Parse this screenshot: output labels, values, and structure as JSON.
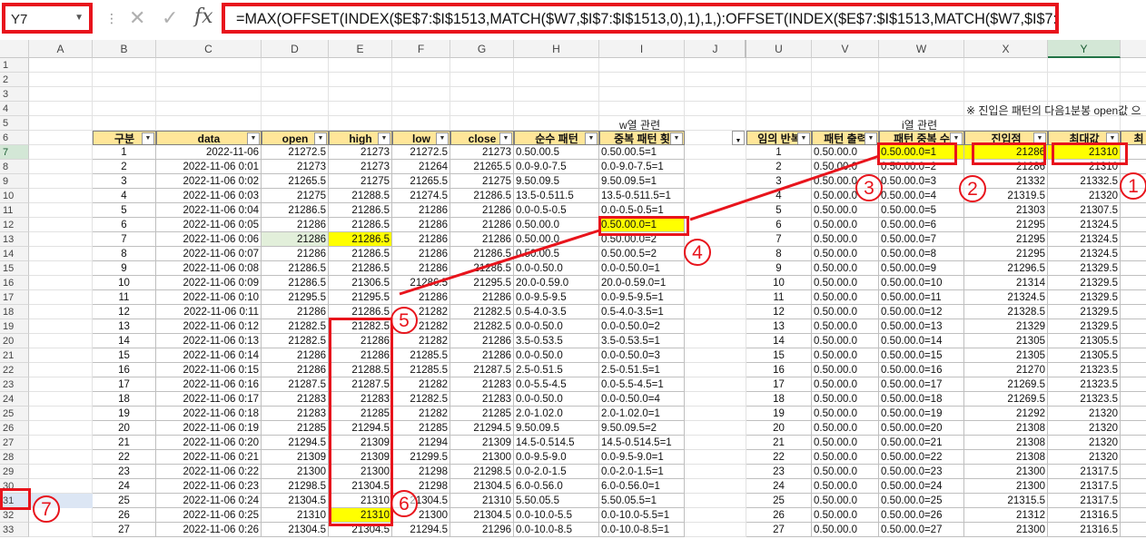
{
  "formula_bar": {
    "name_box": "Y7",
    "formula": "=MAX(OFFSET(INDEX($E$7:$I$1513,MATCH($W7,$I$7:$I$1513,0),1),1,):OFFSET(INDEX($E$7:$I$1513,MATCH($W7,$I$7:$I$1513,0),1),20,))"
  },
  "columns": [
    "A",
    "B",
    "C",
    "D",
    "E",
    "F",
    "G",
    "H",
    "I",
    "J",
    "U",
    "V",
    "W",
    "X",
    "Y"
  ],
  "selected_column": "Y",
  "rows": [
    "1",
    "2",
    "3",
    "4",
    "5",
    "6",
    "7",
    "8",
    "9",
    "10",
    "11",
    "12",
    "13",
    "14",
    "15",
    "16",
    "17",
    "18",
    "19",
    "20",
    "21",
    "22",
    "23",
    "24",
    "25",
    "26",
    "27",
    "28",
    "29",
    "30",
    "31",
    "32",
    "33"
  ],
  "labels": {
    "w_related": "w열 관련",
    "i_related": "i열 관련",
    "note": "※ 진입은 패턴의 다음1분봉 open값 으"
  },
  "left_headers": [
    "구분",
    "data",
    "open",
    "high",
    "low",
    "close",
    "순수 패턴",
    "중복 패턴 횟"
  ],
  "right_headers": [
    "임의 반복",
    "패턴 출력",
    "패턴 중복 수",
    "진입점",
    "최대값",
    "최"
  ],
  "left_rows": [
    [
      "1",
      "2022-11-06",
      "21272.5",
      "21273",
      "21272.5",
      "21273",
      "0.50.00.5",
      "0.50.00.5=1"
    ],
    [
      "2",
      "2022-11-06 0:01",
      "21273",
      "21273",
      "21264",
      "21265.5",
      "0.0-9.0-7.5",
      "0.0-9.0-7.5=1"
    ],
    [
      "3",
      "2022-11-06 0:02",
      "21265.5",
      "21275",
      "21265.5",
      "21275",
      "9.50.09.5",
      "9.50.09.5=1"
    ],
    [
      "4",
      "2022-11-06 0:03",
      "21275",
      "21288.5",
      "21274.5",
      "21286.5",
      "13.5-0.511.5",
      "13.5-0.511.5=1"
    ],
    [
      "5",
      "2022-11-06 0:04",
      "21286.5",
      "21286.5",
      "21286",
      "21286",
      "0.0-0.5-0.5",
      "0.0-0.5-0.5=1"
    ],
    [
      "6",
      "2022-11-06 0:05",
      "21286",
      "21286.5",
      "21286",
      "21286",
      "0.50.00.0",
      "0.50.00.0=1"
    ],
    [
      "7",
      "2022-11-06 0:06",
      "21286",
      "21286.5",
      "21286",
      "21286",
      "0.50.00.0",
      "0.50.00.0=2"
    ],
    [
      "8",
      "2022-11-06 0:07",
      "21286",
      "21286.5",
      "21286",
      "21286.5",
      "0.50.00.5",
      "0.50.00.5=2"
    ],
    [
      "9",
      "2022-11-06 0:08",
      "21286.5",
      "21286.5",
      "21286",
      "21286.5",
      "0.0-0.50.0",
      "0.0-0.50.0=1"
    ],
    [
      "10",
      "2022-11-06 0:09",
      "21286.5",
      "21306.5",
      "21286.5",
      "21295.5",
      "20.0-0.59.0",
      "20.0-0.59.0=1"
    ],
    [
      "11",
      "2022-11-06 0:10",
      "21295.5",
      "21295.5",
      "21286",
      "21286",
      "0.0-9.5-9.5",
      "0.0-9.5-9.5=1"
    ],
    [
      "12",
      "2022-11-06 0:11",
      "21286",
      "21286.5",
      "21282",
      "21282.5",
      "0.5-4.0-3.5",
      "0.5-4.0-3.5=1"
    ],
    [
      "13",
      "2022-11-06 0:12",
      "21282.5",
      "21282.5",
      "21282",
      "21282.5",
      "0.0-0.50.0",
      "0.0-0.50.0=2"
    ],
    [
      "14",
      "2022-11-06 0:13",
      "21282.5",
      "21286",
      "21282",
      "21286",
      "3.5-0.53.5",
      "3.5-0.53.5=1"
    ],
    [
      "15",
      "2022-11-06 0:14",
      "21286",
      "21286",
      "21285.5",
      "21286",
      "0.0-0.50.0",
      "0.0-0.50.0=3"
    ],
    [
      "16",
      "2022-11-06 0:15",
      "21286",
      "21288.5",
      "21285.5",
      "21287.5",
      "2.5-0.51.5",
      "2.5-0.51.5=1"
    ],
    [
      "17",
      "2022-11-06 0:16",
      "21287.5",
      "21287.5",
      "21282",
      "21283",
      "0.0-5.5-4.5",
      "0.0-5.5-4.5=1"
    ],
    [
      "18",
      "2022-11-06 0:17",
      "21283",
      "21283",
      "21282.5",
      "21283",
      "0.0-0.50.0",
      "0.0-0.50.0=4"
    ],
    [
      "19",
      "2022-11-06 0:18",
      "21283",
      "21285",
      "21282",
      "21285",
      "2.0-1.02.0",
      "2.0-1.02.0=1"
    ],
    [
      "20",
      "2022-11-06 0:19",
      "21285",
      "21294.5",
      "21285",
      "21294.5",
      "9.50.09.5",
      "9.50.09.5=2"
    ],
    [
      "21",
      "2022-11-06 0:20",
      "21294.5",
      "21309",
      "21294",
      "21309",
      "14.5-0.514.5",
      "14.5-0.514.5=1"
    ],
    [
      "22",
      "2022-11-06 0:21",
      "21309",
      "21309",
      "21299.5",
      "21300",
      "0.0-9.5-9.0",
      "0.0-9.5-9.0=1"
    ],
    [
      "23",
      "2022-11-06 0:22",
      "21300",
      "21300",
      "21298",
      "21298.5",
      "0.0-2.0-1.5",
      "0.0-2.0-1.5=1"
    ],
    [
      "24",
      "2022-11-06 0:23",
      "21298.5",
      "21304.5",
      "21298",
      "21304.5",
      "6.0-0.56.0",
      "6.0-0.56.0=1"
    ],
    [
      "25",
      "2022-11-06 0:24",
      "21304.5",
      "21310",
      "21304.5",
      "21310",
      "5.50.05.5",
      "5.50.05.5=1"
    ],
    [
      "26",
      "2022-11-06 0:25",
      "21310",
      "21310",
      "21300",
      "21304.5",
      "0.0-10.0-5.5",
      "0.0-10.0-5.5=1"
    ],
    [
      "27",
      "2022-11-06 0:26",
      "21304.5",
      "21304.5",
      "21294.5",
      "21296",
      "0.0-10.0-8.5",
      "0.0-10.0-8.5=1"
    ]
  ],
  "right_rows": [
    [
      "1",
      "0.50.00.0",
      "0.50.00.0=1",
      "21286",
      "21310"
    ],
    [
      "2",
      "0.50.00.0",
      "0.50.00.0=2",
      "21286",
      "21310"
    ],
    [
      "3",
      "0.50.00.0",
      "0.50.00.0=3",
      "21332",
      "21332.5"
    ],
    [
      "4",
      "0.50.00.0",
      "0.50.00.0=4",
      "21319.5",
      "21320"
    ],
    [
      "5",
      "0.50.00.0",
      "0.50.00.0=5",
      "21303",
      "21307.5"
    ],
    [
      "6",
      "0.50.00.0",
      "0.50.00.0=6",
      "21295",
      "21324.5"
    ],
    [
      "7",
      "0.50.00.0",
      "0.50.00.0=7",
      "21295",
      "21324.5"
    ],
    [
      "8",
      "0.50.00.0",
      "0.50.00.0=8",
      "21295",
      "21324.5"
    ],
    [
      "9",
      "0.50.00.0",
      "0.50.00.0=9",
      "21296.5",
      "21329.5"
    ],
    [
      "10",
      "0.50.00.0",
      "0.50.00.0=10",
      "21314",
      "21329.5"
    ],
    [
      "11",
      "0.50.00.0",
      "0.50.00.0=11",
      "21324.5",
      "21329.5"
    ],
    [
      "12",
      "0.50.00.0",
      "0.50.00.0=12",
      "21328.5",
      "21329.5"
    ],
    [
      "13",
      "0.50.00.0",
      "0.50.00.0=13",
      "21329",
      "21329.5"
    ],
    [
      "14",
      "0.50.00.0",
      "0.50.00.0=14",
      "21305",
      "21305.5"
    ],
    [
      "15",
      "0.50.00.0",
      "0.50.00.0=15",
      "21305",
      "21305.5"
    ],
    [
      "16",
      "0.50.00.0",
      "0.50.00.0=16",
      "21270",
      "21323.5"
    ],
    [
      "17",
      "0.50.00.0",
      "0.50.00.0=17",
      "21269.5",
      "21323.5"
    ],
    [
      "18",
      "0.50.00.0",
      "0.50.00.0=18",
      "21269.5",
      "21323.5"
    ],
    [
      "19",
      "0.50.00.0",
      "0.50.00.0=19",
      "21292",
      "21320"
    ],
    [
      "20",
      "0.50.00.0",
      "0.50.00.0=20",
      "21308",
      "21320"
    ],
    [
      "21",
      "0.50.00.0",
      "0.50.00.0=21",
      "21308",
      "21320"
    ],
    [
      "22",
      "0.50.00.0",
      "0.50.00.0=22",
      "21308",
      "21320"
    ],
    [
      "23",
      "0.50.00.0",
      "0.50.00.0=23",
      "21300",
      "21317.5"
    ],
    [
      "24",
      "0.50.00.0",
      "0.50.00.0=24",
      "21300",
      "21317.5"
    ],
    [
      "25",
      "0.50.00.0",
      "0.50.00.0=25",
      "21315.5",
      "21317.5"
    ],
    [
      "26",
      "0.50.00.0",
      "0.50.00.0=26",
      "21312",
      "21316.5"
    ],
    [
      "27",
      "0.50.00.0",
      "0.50.00.0=27",
      "21300",
      "21316.5"
    ]
  ],
  "annotations": [
    "1",
    "2",
    "3",
    "4",
    "5",
    "6",
    "7"
  ],
  "colors": {
    "annotation_red": "#e8141c",
    "highlight_yellow": "#ffff00",
    "header_fill": "#ffe699",
    "selected_header": "#d3e7d6",
    "excel_green": "#217346"
  },
  "icons": [
    "dropdown-arrow-icon",
    "cancel-x-icon",
    "confirm-check-icon",
    "fx-icon",
    "filter-dropdown-icon"
  ]
}
